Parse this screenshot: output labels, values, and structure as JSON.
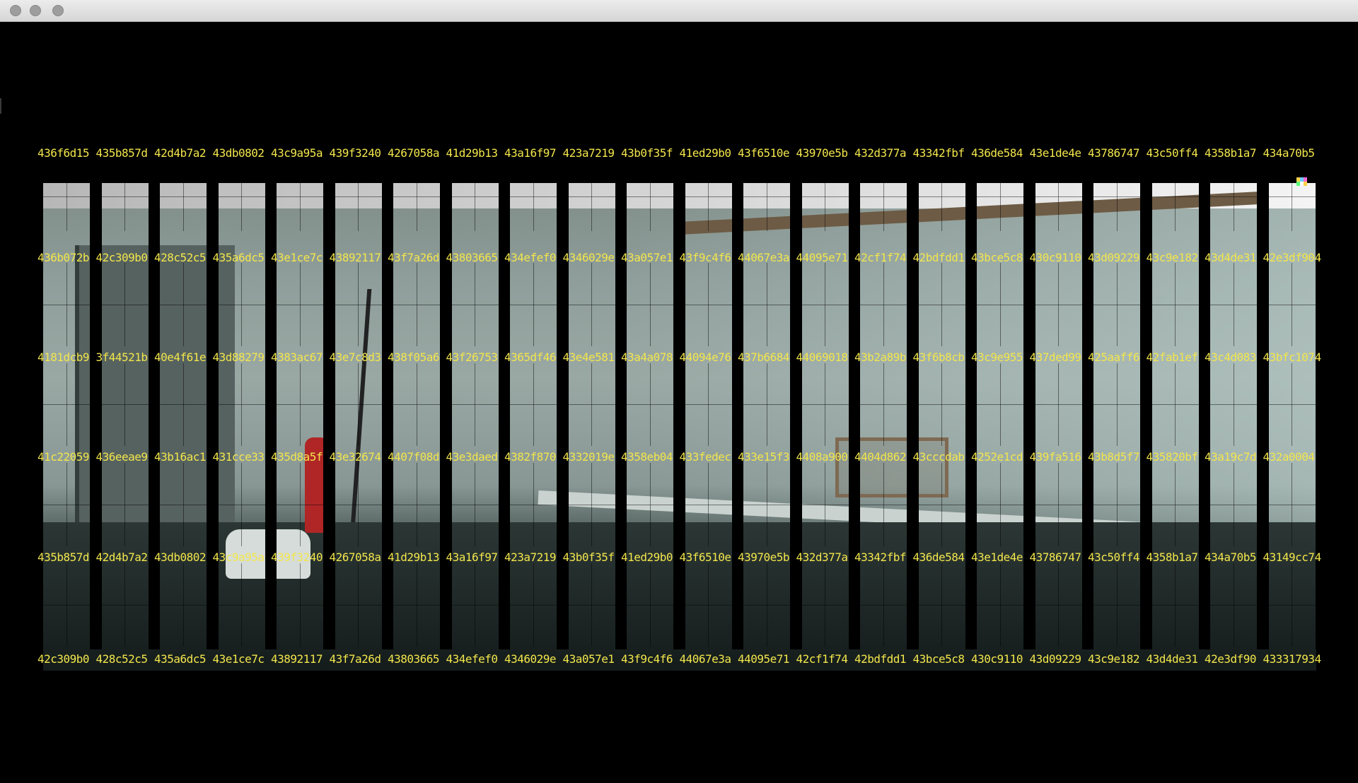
{
  "colors": {
    "label": "#f2e64c",
    "background": "#000000",
    "titlebar": "#e3e3e3"
  },
  "window": {
    "controls": [
      "close",
      "minimize",
      "zoom"
    ]
  },
  "label_rows": [
    [
      "436f6d15",
      "435b857d",
      "42d4b7a2",
      "43db0802",
      "43c9a95a",
      "439f3240",
      "4267058a",
      "41d29b13",
      "43a16f97",
      "423a7219",
      "43b0f35f",
      "41ed29b0",
      "43f6510e",
      "43970e5b",
      "432d377a",
      "43342fbf",
      "436de584",
      "43e1de4e",
      "43786747",
      "43c50ff4",
      "4358b1a7",
      "434a70b5"
    ],
    [
      "436b072b",
      "42c309b0",
      "428c52c5",
      "435a6dc5",
      "43e1ce7c",
      "43892117",
      "43f7a26d",
      "43803665",
      "434efef0",
      "4346029e",
      "43a057e1",
      "43f9c4f6",
      "44067e3a",
      "44095e71",
      "42cf1f74",
      "42bdfdd1",
      "43bce5c8",
      "430c9110",
      "43d09229",
      "43c9e182",
      "43d4de31",
      "42e3df904"
    ],
    [
      "4181dcb9",
      "3f44521b",
      "40e4f61e",
      "43d88279",
      "4383ac67",
      "43e7c8d3",
      "438f05a6",
      "43f26753",
      "4365df46",
      "43e4e581",
      "43a4a078",
      "44094e76",
      "437b6684",
      "44069018",
      "43b2a89b",
      "43f6b8cb",
      "43c9e955",
      "437ded99",
      "425aaff6",
      "42fab1ef",
      "43c4d083",
      "43bfc1074"
    ],
    [
      "41c22059",
      "436eeae9",
      "43b16ac1",
      "431cce33",
      "435d8a5f",
      "43e32674",
      "4407f08d",
      "43e3daed",
      "4382f870",
      "4332019e",
      "4358eb04",
      "433fedec",
      "433e15f3",
      "4408a900",
      "4404d862",
      "43cccdab",
      "4252e1cd",
      "439fa516",
      "43b8d5f7",
      "435820bf",
      "43a19c7d",
      "432a0004"
    ],
    [
      "435b857d",
      "42d4b7a2",
      "43db0802",
      "43c9a95a",
      "439f3240",
      "4267058a",
      "41d29b13",
      "43a16f97",
      "423a7219",
      "43b0f35f",
      "41ed29b0",
      "43f6510e",
      "43970e5b",
      "432d377a",
      "43342fbf",
      "436de584",
      "43e1de4e",
      "43786747",
      "43c50ff4",
      "4358b1a7",
      "434a70b5",
      "43149cc74"
    ],
    [
      "42c309b0",
      "428c52c5",
      "435a6dc5",
      "43e1ce7c",
      "43892117",
      "43f7a26d",
      "43803665",
      "434efef0",
      "4346029e",
      "43a057e1",
      "43f9c4f6",
      "44067e3a",
      "44095e71",
      "42cf1f74",
      "42bdfdd1",
      "43bce5c8",
      "430c9110",
      "43d09229",
      "43c9e182",
      "43d4de31",
      "42e3df90",
      "433317934"
    ]
  ]
}
